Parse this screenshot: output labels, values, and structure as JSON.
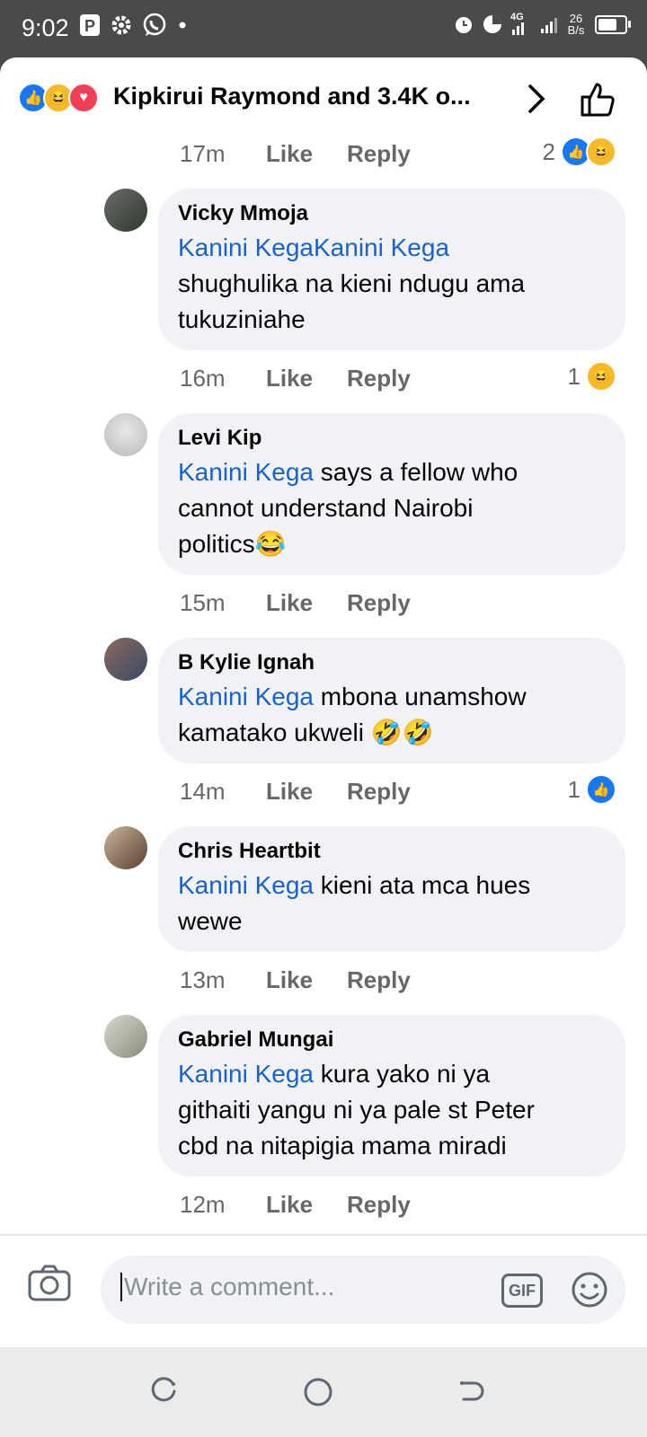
{
  "status_bar": {
    "time": "9:02",
    "network_label": "4G",
    "speed_value": "26",
    "speed_unit": "B/s"
  },
  "header": {
    "title": "Kipkirui Raymond and 3.4K o...",
    "reaction_icons": [
      "like-icon",
      "haha-icon",
      "love-icon"
    ]
  },
  "top_comment_meta": {
    "time": "17m",
    "like_label": "Like",
    "reply_label": "Reply",
    "reaction_count": "2"
  },
  "comments": [
    {
      "author": "Vicky Mmoja",
      "mention": "Kanini KegaKanini Kega",
      "text_line1": "",
      "text_line2": "shughulika na kieni ndugu  ama",
      "text_line3": "tukuziniahe",
      "time": "16m",
      "like_label": "Like",
      "reply_label": "Reply",
      "reaction_count": "1"
    },
    {
      "author": "Levi Kip",
      "mention": "Kanini Kega",
      "text_line1": " says a fellow who",
      "text_line2": "cannot understand Nairobi",
      "text_line3": "politics😂",
      "time": "15m",
      "like_label": "Like",
      "reply_label": "Reply",
      "reaction_count": ""
    },
    {
      "author": "B Kylie Ignah",
      "mention": "Kanini Kega",
      "text_line1": " mbona unamshow",
      "text_line2": "kamatako ukweli 🤣🤣",
      "text_line3": "",
      "time": "14m",
      "like_label": "Like",
      "reply_label": "Reply",
      "reaction_count": "1"
    },
    {
      "author": "Chris Heartbit",
      "mention": "Kanini Kega",
      "text_line1": " kieni ata mca hues",
      "text_line2": "wewe",
      "text_line3": "",
      "time": "13m",
      "like_label": "Like",
      "reply_label": "Reply",
      "reaction_count": ""
    },
    {
      "author": "Gabriel Mungai",
      "mention": "Kanini Kega",
      "text_line1": " kura yako ni ya",
      "text_line2": "githaiti yangu ni ya pale st Peter",
      "text_line3": "cbd na nitapigia mama miradi",
      "time": "12m",
      "like_label": "Like",
      "reply_label": "Reply",
      "reaction_count": ""
    }
  ],
  "composer": {
    "placeholder": "Write a comment...",
    "gif_label": "GIF"
  },
  "colors": {
    "accent": "#1877f2",
    "mention": "#1a62c8",
    "bubble": "#f0f2f5",
    "meta_text": "#65676b"
  }
}
